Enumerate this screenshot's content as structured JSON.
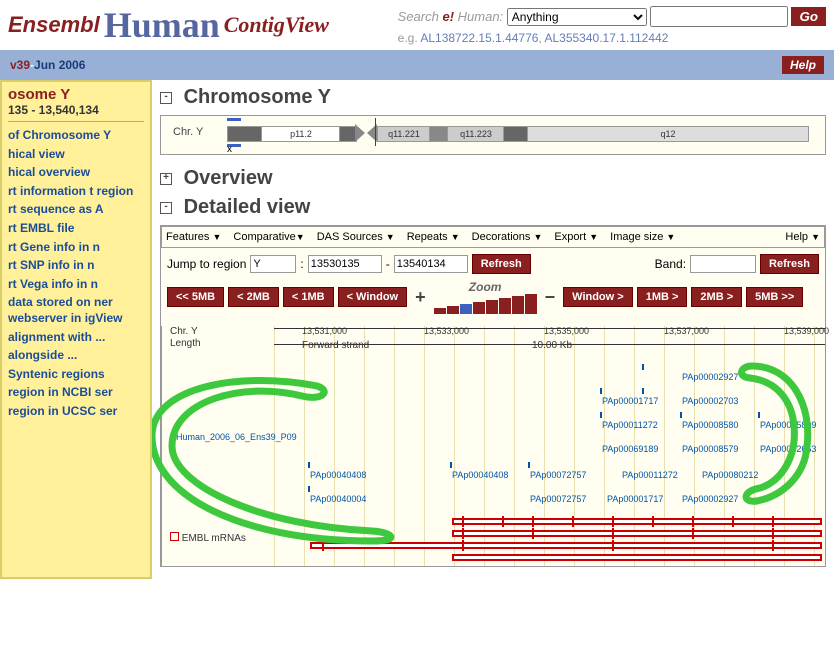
{
  "header": {
    "logo_prefix": "Ensembl",
    "logo_main": "Human",
    "logo_suffix": "ContigView",
    "search_label_prefix": "Search ",
    "search_label_em": "e!",
    "search_label_suffix": " Human:",
    "search_dropdown": "Anything",
    "search_value": "",
    "go": "Go",
    "eg_prefix": "e.g. ",
    "eg_link1": "AL138722.15.1.44776",
    "eg_link2": "AL355340.17.1.112442"
  },
  "version_bar": {
    "version": "v39",
    "sep": " - ",
    "date": "Jun 2006",
    "help": "Help"
  },
  "sidebar": {
    "title": "osome Y",
    "range": "135 - 13,540,134",
    "links": [
      "of Chromosome Y",
      "hical view",
      "hical overview",
      "rt information t region",
      "rt sequence as A",
      "rt EMBL file",
      "rt Gene info in n",
      "rt SNP info in n",
      "rt Vega info in n",
      "data stored on ner webserver in igView",
      "alignment with ...",
      "alongside ...",
      "Syntenic regions",
      "region in NCBI ser",
      "region in UCSC ser"
    ]
  },
  "sections": {
    "chromosome_title": "Chromosome Y",
    "overview_title": "Overview",
    "detailed_title": "Detailed view"
  },
  "ideogram": {
    "chr_label": "Chr. Y",
    "x_label": "x",
    "bands": [
      "p11.2",
      "q11.221",
      "q11.223",
      "q12"
    ]
  },
  "menu": {
    "items": [
      "Features",
      "Comparative",
      "DAS Sources",
      "Repeats",
      "Decorations",
      "Export",
      "Image size"
    ],
    "help": "Help"
  },
  "jump": {
    "label": "Jump to region",
    "chr": "Y",
    "start": "13530135",
    "end": "13540134",
    "refresh": "Refresh",
    "band_label": "Band:",
    "band_value": ""
  },
  "nav": {
    "left": [
      "<< 5MB",
      "< 2MB",
      "< 1MB",
      "< Window"
    ],
    "zoom": "Zoom",
    "right": [
      "Window >",
      "1MB >",
      "2MB >",
      "5MB >>"
    ]
  },
  "tracks": {
    "chr_label": "Chr. Y",
    "length_label": "Length",
    "strand_label": "Forward strand",
    "length_value": "10.00 Kb",
    "ruler_ticks": [
      "13,531,000",
      "13,533,000",
      "13,535,000",
      "13,537,000",
      "13,539,000"
    ],
    "track_source": "Human_2006_06_Ens39_P09",
    "pa_ids": [
      "PAp00002927",
      "PAp00001717",
      "PAp00002703",
      "PAp00011272",
      "PAp00008580",
      "PAp00025809",
      "PAp00069189",
      "PAp00008579",
      "PAp00002653",
      "PAp00040408",
      "PAp00040408",
      "PAp00072757",
      "PAp00011272",
      "PAp00080212",
      "PAp00040004",
      "PAp00072757",
      "PAp00001717",
      "PAp00002927"
    ],
    "embl_label": "EMBL mRNAs"
  }
}
